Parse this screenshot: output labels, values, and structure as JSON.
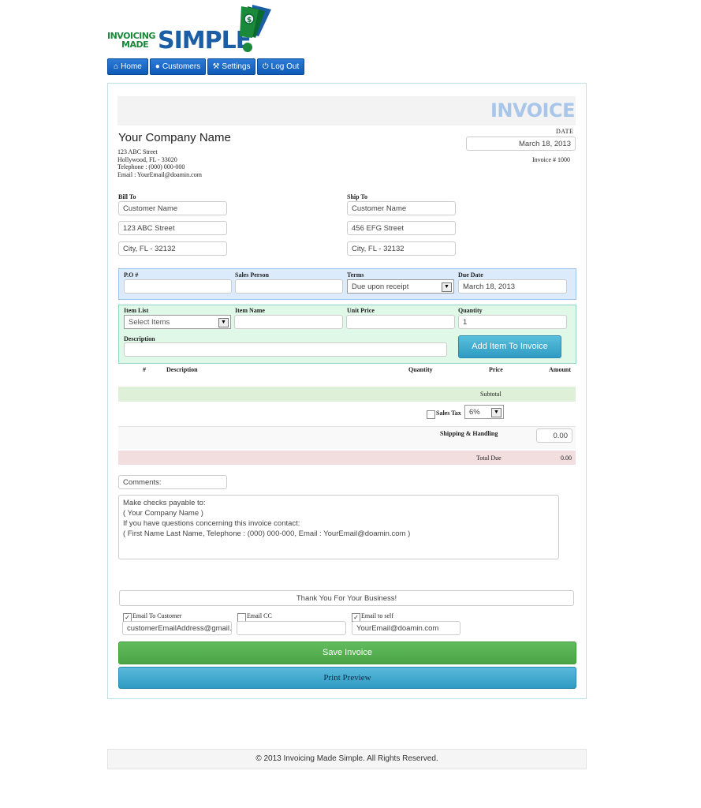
{
  "logo": {
    "line1": "INVOICING",
    "line2": "MADE",
    "word": "SIMPLE",
    "bang": "!"
  },
  "nav": [
    {
      "label": "Home",
      "icon": "home-icon"
    },
    {
      "label": "Customers",
      "icon": "user-icon"
    },
    {
      "label": "Settings",
      "icon": "wrench-icon"
    },
    {
      "label": "Log Out",
      "icon": "power-icon"
    }
  ],
  "invoice": {
    "title": "INVOICE",
    "company": "Your Company Name",
    "address": [
      "123 ABC Street",
      "Hollywood, FL - 33020",
      "Telephone : (000) 000-000",
      "Email : YourEmail@doamin.com"
    ],
    "date_label": "DATE",
    "date": "March 18, 2013",
    "invoice_no": "Invoice # 1000"
  },
  "bill_to": {
    "label": "Bill To",
    "name": "Customer Name",
    "street": "123 ABC Street",
    "city": "City, FL - 32132"
  },
  "ship_to": {
    "label": "Ship To",
    "name": "Customer Name",
    "street": "456 EFG Street",
    "city": "City, FL - 32132"
  },
  "order": {
    "po_label": "P.O #",
    "po": "",
    "sales_label": "Sales Person",
    "sales": "",
    "terms_label": "Terms",
    "terms": "Due upon receipt",
    "due_label": "Due Date",
    "due": "March 18, 2013"
  },
  "item": {
    "list_label": "Item List",
    "list_value": "Select Items",
    "name_label": "Item Name",
    "name": "",
    "price_label": "Unit Price",
    "price": "",
    "qty_label": "Quantity",
    "qty": "1",
    "desc_label": "Description",
    "desc": "",
    "add_button": "Add Item To Invoice"
  },
  "table": {
    "headers": [
      "#",
      "Description",
      "Quantity",
      "Price",
      "Amount"
    ]
  },
  "totals": {
    "subtotal_label": "Subtotal",
    "tax_label": "Sales Tax",
    "tax_value": "6%",
    "shipping_label": "Shipping & Handling",
    "shipping_value": "0.00",
    "total_label": "Total Due",
    "total_value": "0.00"
  },
  "comments": {
    "label": "Comments:",
    "text": [
      "Make checks payable to:",
      "( Your Company Name )",
      "If you have questions concerning this invoice contact:",
      "( First Name Last Name, Telephone : (000) 000-000, Email : YourEmail@doamin.com )"
    ]
  },
  "thanks": "Thank You For Your Business!",
  "email": {
    "to_customer_label": "Email To Customer",
    "to_customer_value": "customerEmailAddress@gmail.com",
    "cc_label": "Email CC",
    "cc_value": "",
    "self_label": "Email to self",
    "self_value": "YourEmail@doamin.com"
  },
  "buttons": {
    "save": "Save Invoice",
    "print": "Print Preview"
  },
  "footer": "© 2013 Invoicing Made Simple. All Rights Reserved.",
  "colors": {
    "nav": "#0f5bb8",
    "save": "#57b054",
    "print": "#3da7cc",
    "order_bg": "#dcebfb",
    "item_bg": "#dff8e8",
    "subtotal_bg": "#dff0d8",
    "total_bg": "#f2dede"
  }
}
